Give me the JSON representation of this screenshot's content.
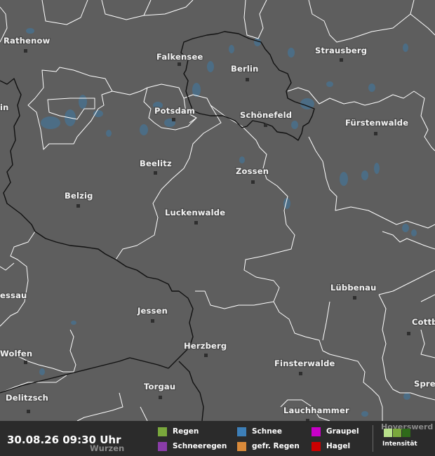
{
  "timestamp": "30.08.26 09:30 Uhr",
  "cities": {
    "rathenow": "Rathenow",
    "falkensee": "Falkensee",
    "berlin": "Berlin",
    "strausberg": "Strausberg",
    "potsdam": "Potsdam",
    "schoenefeld": "Schönefeld",
    "fuerstenwalde": "Fürstenwalde",
    "beelitz": "Beelitz",
    "zossen": "Zossen",
    "belzig": "Belzig",
    "luckenwalde": "Luckenwalde",
    "luebbenau": "Lübbenau",
    "jessen": "Jessen",
    "herzberg": "Herzberg",
    "finsterwalde": "Finsterwalde",
    "torgau": "Torgau",
    "delitzsch": "Delitzsch",
    "lauchhammer": "Lauchhammer",
    "wolfen": "Wolfen",
    "dessau": "essau",
    "cottbus": "Cottb",
    "spremberg": "Spre",
    "hoyerswerda": "Hoyerswerd",
    "wurzen": "Wurzen",
    "left_edge": "in"
  },
  "legend": {
    "regen": "Regen",
    "schnee": "Schnee",
    "graupel": "Graupel",
    "schneeregen": "Schneeregen",
    "gefr_regen": "gefr. Regen",
    "hagel": "Hagel",
    "intensity_label": "Intensität"
  },
  "colors": {
    "regen": "#7aa83c",
    "schnee": "#3d7fb8",
    "graupel": "#c800c8",
    "schneeregen": "#8a3ca8",
    "gefr_regen": "#d98a3a",
    "hagel": "#cc0000",
    "intensity": [
      "#b8e08a",
      "#7aa83c",
      "#2f6a1a"
    ]
  }
}
